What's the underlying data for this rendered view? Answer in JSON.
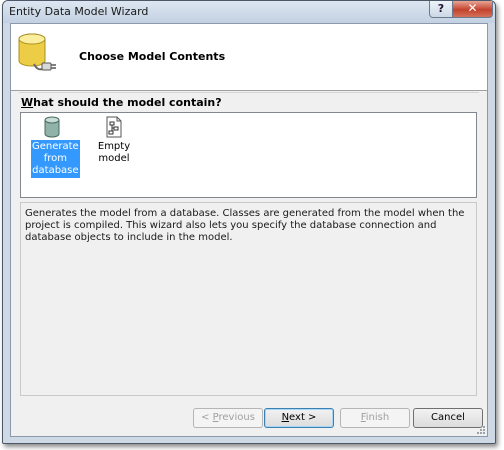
{
  "window": {
    "title": "Entity Data Model Wizard",
    "help_glyph": "?",
    "close_glyph": "✕"
  },
  "header": {
    "title": "Choose Model Contents",
    "icon": "database-plug-icon"
  },
  "question": {
    "accel": "W",
    "rest": "hat should the model contain?"
  },
  "model_options": [
    {
      "line1": "Generate",
      "line2": "from",
      "line3": "database",
      "icon": "database-icon",
      "selected": true
    },
    {
      "label": "Empty model",
      "icon": "empty-model-icon",
      "selected": false
    }
  ],
  "description": "Generates the model from a database. Classes are generated from the model when the project is compiled. This wizard also lets you specify the database connection and database objects to include in the model.",
  "buttons": {
    "previous": {
      "prefix": "< ",
      "accel": "P",
      "rest": "revious",
      "enabled": false
    },
    "next": {
      "accel": "N",
      "rest": "ext >",
      "enabled": true
    },
    "finish": {
      "accel": "F",
      "rest": "inish",
      "enabled": false
    },
    "cancel": {
      "label": "Cancel",
      "enabled": true
    }
  },
  "colors": {
    "selection": "#3399ff",
    "close_button": "#c4432c"
  }
}
